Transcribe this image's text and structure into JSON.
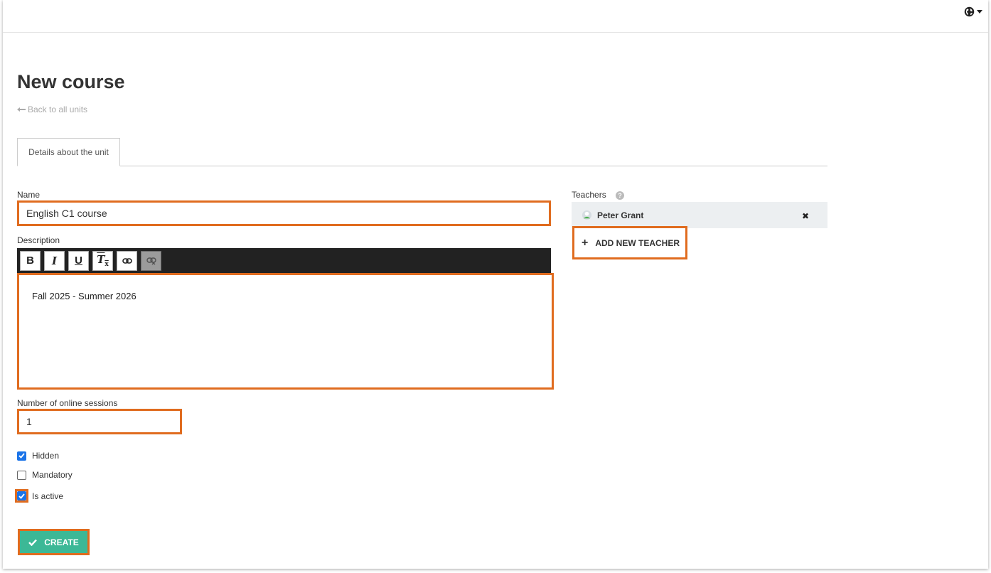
{
  "page": {
    "title": "New course",
    "back_link": "Back to all units"
  },
  "tabs": [
    {
      "label": "Details about the unit",
      "active": true
    }
  ],
  "form": {
    "name_label": "Name",
    "name_value": "English C1 course",
    "description_label": "Description",
    "description_value": "Fall 2025 - Summer 2026",
    "sessions_label": "Number of online sessions",
    "sessions_value": "1",
    "checkboxes": [
      {
        "label": "Hidden",
        "checked": true
      },
      {
        "label": "Mandatory",
        "checked": false
      },
      {
        "label": "Is active",
        "checked": true
      }
    ],
    "create_label": "CREATE"
  },
  "toolbar": {
    "buttons": [
      "bold-icon",
      "italic-icon",
      "underline-icon",
      "clear-format-icon",
      "link-icon",
      "unlink-icon"
    ]
  },
  "teachers": {
    "label": "Teachers",
    "items": [
      {
        "name": "Peter Grant"
      }
    ],
    "add_label": "ADD NEW TEACHER"
  },
  "colors": {
    "highlight": "#e06c1f",
    "create_button": "#3cb896",
    "checkbox": "#1a73e8",
    "toolbar_bg": "#222222"
  }
}
